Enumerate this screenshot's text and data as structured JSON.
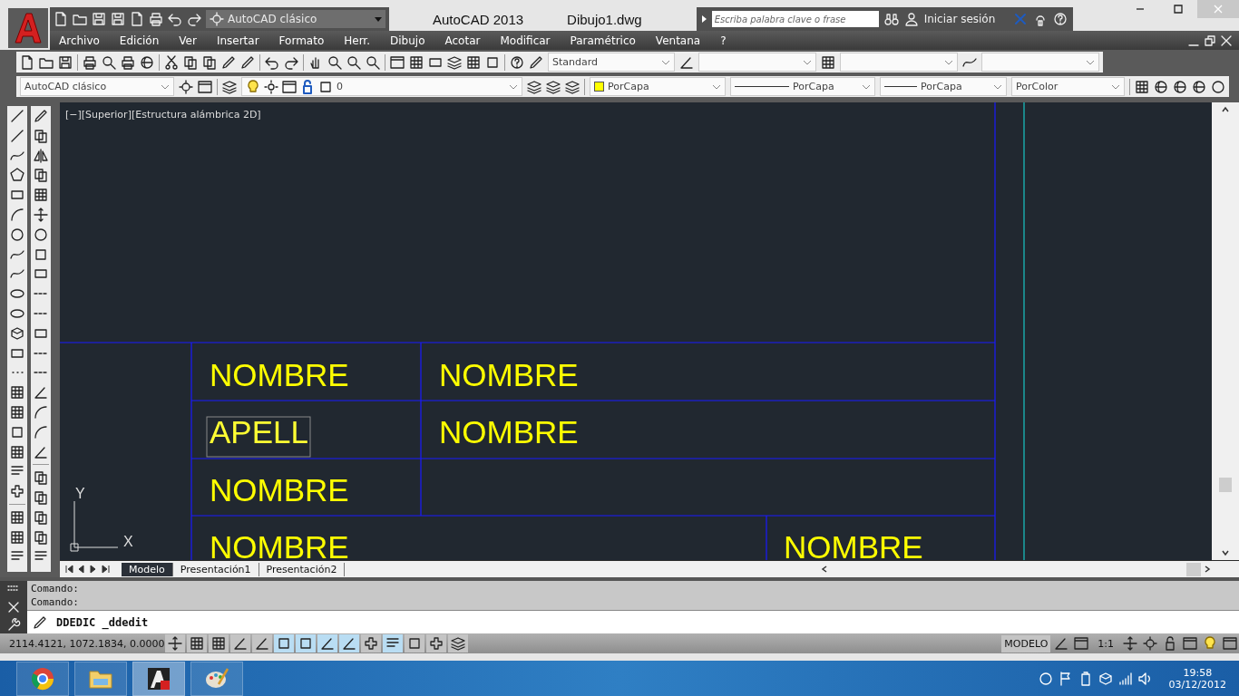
{
  "title_bar": {
    "workspace": "AutoCAD clásico",
    "app_name": "AutoCAD 2013",
    "file_name": "Dibujo1.dwg",
    "search_placeholder": "Escriba palabra clave o frase",
    "sign_in": "Iniciar sesión"
  },
  "menu": [
    "Archivo",
    "Edición",
    "Ver",
    "Insertar",
    "Formato",
    "Herr.",
    "Dibujo",
    "Acotar",
    "Modificar",
    "Paramétrico",
    "Ventana",
    "?"
  ],
  "styles_toolbar": {
    "text_style": "Standard"
  },
  "layers_toolbar": {
    "workspace": "AutoCAD clásico",
    "layer": "0",
    "color_setting": "PorCapa",
    "linetype": "PorCapa",
    "lineweight": "PorCapa",
    "plot_style": "PorColor"
  },
  "viewport": {
    "label": "[−][Superior][Estructura alámbrica 2D]",
    "axis_x": "X",
    "axis_y": "Y",
    "rows": [
      [
        {
          "text": "NOMBRE",
          "selected": false
        },
        {
          "text": "NOMBRE",
          "selected": false
        }
      ],
      [
        {
          "text": "APELL",
          "selected": true
        },
        {
          "text": "NOMBRE",
          "selected": false
        }
      ],
      [
        {
          "text": "NOMBRE",
          "selected": false
        }
      ],
      [
        {
          "text": "NOMBRE",
          "selected": false
        },
        {
          "text": "NOMBRE",
          "selected": false
        }
      ]
    ]
  },
  "layout_tabs": [
    {
      "label": "Modelo",
      "selected": true
    },
    {
      "label": "Presentación1",
      "selected": false
    },
    {
      "label": "Presentación2",
      "selected": false
    }
  ],
  "command": {
    "history": [
      "Comando:",
      "Comando:"
    ],
    "input": "DDEDIC _ddedit"
  },
  "status_bar": {
    "coordinates": "2114.4121, 1072.1834, 0.0000",
    "space": "MODELO",
    "scale": "1:1",
    "toggles": [
      {
        "on": false
      },
      {
        "on": false
      },
      {
        "on": false
      },
      {
        "on": false
      },
      {
        "on": false
      },
      {
        "on": true
      },
      {
        "on": true
      },
      {
        "on": true
      },
      {
        "on": true
      },
      {
        "on": false
      },
      {
        "on": true
      },
      {
        "on": false
      },
      {
        "on": false
      },
      {
        "on": false
      }
    ]
  },
  "taskbar": {
    "apps": [
      {
        "kind": "browser",
        "selected": false
      },
      {
        "kind": "folder",
        "selected": false
      },
      {
        "kind": "cad",
        "selected": true
      },
      {
        "kind": "paint",
        "selected": false
      }
    ],
    "time": "19:58",
    "date": "03/12/2012"
  }
}
